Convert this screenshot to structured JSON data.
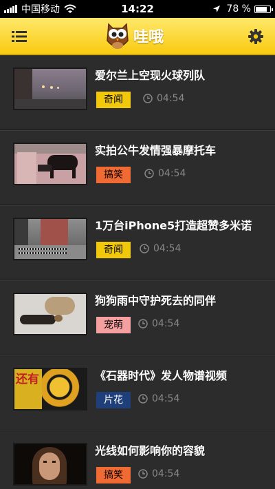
{
  "status_bar": {
    "carrier": "中国移动",
    "time": "14:22",
    "battery_percent": "78 %",
    "battery_level": 0.78
  },
  "nav": {
    "app_name": "哇哦"
  },
  "colors": {
    "nav_yellow": "#f8ca0f",
    "tag_news": "#f2c80d",
    "tag_funny": "#f06a34",
    "tag_cute": "#f4a0a0",
    "tag_trailer": "#1e3f7a"
  },
  "items": [
    {
      "title": "爱尔兰上空现火球列队",
      "tag": "奇闻",
      "time": "04:54"
    },
    {
      "title": "实拍公牛发情强暴摩托车",
      "tag": "搞笑",
      "time": "04:54"
    },
    {
      "title": "1万台iPhone5打造超赞多米诺",
      "tag": "奇闻",
      "time": "04:54"
    },
    {
      "title": "狗狗雨中守护死去的同伴",
      "tag": "宠萌",
      "time": "04:54"
    },
    {
      "title": "《石器时代》发人物谱视频",
      "tag": "片花",
      "time": "04:54"
    },
    {
      "title": "光线如何影响你的容貌",
      "tag": "搞笑",
      "time": "04:54"
    }
  ]
}
